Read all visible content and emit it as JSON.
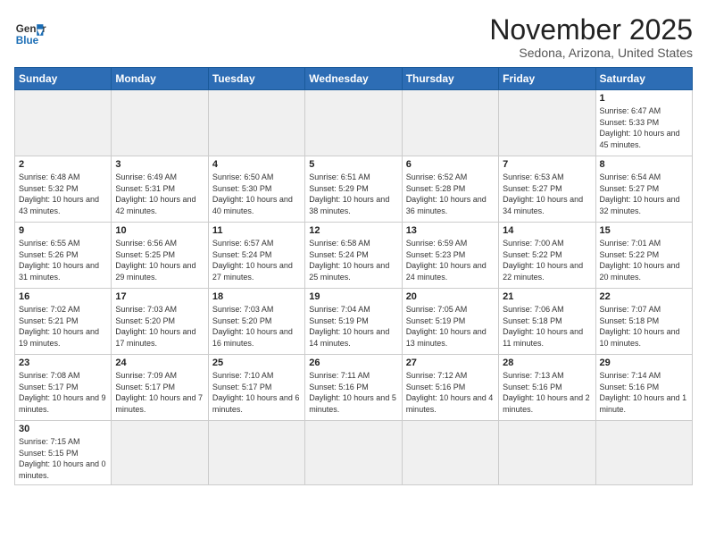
{
  "logo": {
    "line1": "General",
    "line2": "Blue"
  },
  "title": "November 2025",
  "subtitle": "Sedona, Arizona, United States",
  "weekdays": [
    "Sunday",
    "Monday",
    "Tuesday",
    "Wednesday",
    "Thursday",
    "Friday",
    "Saturday"
  ],
  "weeks": [
    [
      {
        "day": "",
        "info": ""
      },
      {
        "day": "",
        "info": ""
      },
      {
        "day": "",
        "info": ""
      },
      {
        "day": "",
        "info": ""
      },
      {
        "day": "",
        "info": ""
      },
      {
        "day": "",
        "info": ""
      },
      {
        "day": "1",
        "info": "Sunrise: 6:47 AM\nSunset: 5:33 PM\nDaylight: 10 hours\nand 45 minutes."
      }
    ],
    [
      {
        "day": "2",
        "info": "Sunrise: 6:48 AM\nSunset: 5:32 PM\nDaylight: 10 hours\nand 43 minutes."
      },
      {
        "day": "3",
        "info": "Sunrise: 6:49 AM\nSunset: 5:31 PM\nDaylight: 10 hours\nand 42 minutes."
      },
      {
        "day": "4",
        "info": "Sunrise: 6:50 AM\nSunset: 5:30 PM\nDaylight: 10 hours\nand 40 minutes."
      },
      {
        "day": "5",
        "info": "Sunrise: 6:51 AM\nSunset: 5:29 PM\nDaylight: 10 hours\nand 38 minutes."
      },
      {
        "day": "6",
        "info": "Sunrise: 6:52 AM\nSunset: 5:28 PM\nDaylight: 10 hours\nand 36 minutes."
      },
      {
        "day": "7",
        "info": "Sunrise: 6:53 AM\nSunset: 5:27 PM\nDaylight: 10 hours\nand 34 minutes."
      },
      {
        "day": "8",
        "info": "Sunrise: 6:54 AM\nSunset: 5:27 PM\nDaylight: 10 hours\nand 32 minutes."
      }
    ],
    [
      {
        "day": "9",
        "info": "Sunrise: 6:55 AM\nSunset: 5:26 PM\nDaylight: 10 hours\nand 31 minutes."
      },
      {
        "day": "10",
        "info": "Sunrise: 6:56 AM\nSunset: 5:25 PM\nDaylight: 10 hours\nand 29 minutes."
      },
      {
        "day": "11",
        "info": "Sunrise: 6:57 AM\nSunset: 5:24 PM\nDaylight: 10 hours\nand 27 minutes."
      },
      {
        "day": "12",
        "info": "Sunrise: 6:58 AM\nSunset: 5:24 PM\nDaylight: 10 hours\nand 25 minutes."
      },
      {
        "day": "13",
        "info": "Sunrise: 6:59 AM\nSunset: 5:23 PM\nDaylight: 10 hours\nand 24 minutes."
      },
      {
        "day": "14",
        "info": "Sunrise: 7:00 AM\nSunset: 5:22 PM\nDaylight: 10 hours\nand 22 minutes."
      },
      {
        "day": "15",
        "info": "Sunrise: 7:01 AM\nSunset: 5:22 PM\nDaylight: 10 hours\nand 20 minutes."
      }
    ],
    [
      {
        "day": "16",
        "info": "Sunrise: 7:02 AM\nSunset: 5:21 PM\nDaylight: 10 hours\nand 19 minutes."
      },
      {
        "day": "17",
        "info": "Sunrise: 7:03 AM\nSunset: 5:20 PM\nDaylight: 10 hours\nand 17 minutes."
      },
      {
        "day": "18",
        "info": "Sunrise: 7:03 AM\nSunset: 5:20 PM\nDaylight: 10 hours\nand 16 minutes."
      },
      {
        "day": "19",
        "info": "Sunrise: 7:04 AM\nSunset: 5:19 PM\nDaylight: 10 hours\nand 14 minutes."
      },
      {
        "day": "20",
        "info": "Sunrise: 7:05 AM\nSunset: 5:19 PM\nDaylight: 10 hours\nand 13 minutes."
      },
      {
        "day": "21",
        "info": "Sunrise: 7:06 AM\nSunset: 5:18 PM\nDaylight: 10 hours\nand 11 minutes."
      },
      {
        "day": "22",
        "info": "Sunrise: 7:07 AM\nSunset: 5:18 PM\nDaylight: 10 hours\nand 10 minutes."
      }
    ],
    [
      {
        "day": "23",
        "info": "Sunrise: 7:08 AM\nSunset: 5:17 PM\nDaylight: 10 hours\nand 9 minutes."
      },
      {
        "day": "24",
        "info": "Sunrise: 7:09 AM\nSunset: 5:17 PM\nDaylight: 10 hours\nand 7 minutes."
      },
      {
        "day": "25",
        "info": "Sunrise: 7:10 AM\nSunset: 5:17 PM\nDaylight: 10 hours\nand 6 minutes."
      },
      {
        "day": "26",
        "info": "Sunrise: 7:11 AM\nSunset: 5:16 PM\nDaylight: 10 hours\nand 5 minutes."
      },
      {
        "day": "27",
        "info": "Sunrise: 7:12 AM\nSunset: 5:16 PM\nDaylight: 10 hours\nand 4 minutes."
      },
      {
        "day": "28",
        "info": "Sunrise: 7:13 AM\nSunset: 5:16 PM\nDaylight: 10 hours\nand 2 minutes."
      },
      {
        "day": "29",
        "info": "Sunrise: 7:14 AM\nSunset: 5:16 PM\nDaylight: 10 hours\nand 1 minute."
      }
    ],
    [
      {
        "day": "30",
        "info": "Sunrise: 7:15 AM\nSunset: 5:15 PM\nDaylight: 10 hours\nand 0 minutes."
      },
      {
        "day": "",
        "info": ""
      },
      {
        "day": "",
        "info": ""
      },
      {
        "day": "",
        "info": ""
      },
      {
        "day": "",
        "info": ""
      },
      {
        "day": "",
        "info": ""
      },
      {
        "day": "",
        "info": ""
      }
    ]
  ]
}
